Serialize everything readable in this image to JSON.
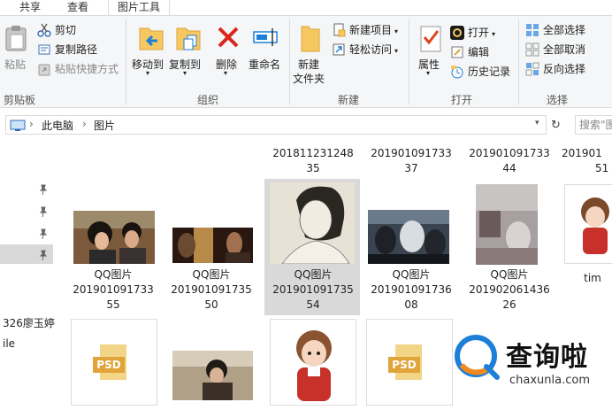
{
  "tabs": {
    "share": "共享",
    "view": "查看",
    "picture_tools": "图片工具"
  },
  "ribbon": {
    "clipboard": {
      "paste": "粘贴",
      "cut": "剪切",
      "copy_path": "复制路径",
      "paste_shortcut": "粘贴快捷方式",
      "label": "剪贴板"
    },
    "organize": {
      "move_to": "移动到",
      "copy_to": "复制到",
      "delete": "删除",
      "rename": "重命名",
      "label": "组织"
    },
    "new": {
      "new_folder_line1": "新建",
      "new_folder_line2": "文件夹",
      "new_item": "新建项目",
      "easy_access": "轻松访问",
      "label": "新建"
    },
    "open": {
      "properties": "属性",
      "open": "打开",
      "edit": "编辑",
      "history": "历史记录",
      "label": "打开"
    },
    "select": {
      "select_all": "全部选择",
      "select_none": "全部取消",
      "invert": "反向选择",
      "label": "选择"
    }
  },
  "address": {
    "this_pc": "此电脑",
    "pictures": "图片",
    "search_placeholder": "搜索\"图"
  },
  "nav": {
    "item_326": "326廖玉婷",
    "item_file": "ile"
  },
  "files": {
    "row0": [
      {
        "line1": "201811231248",
        "line2": "35"
      },
      {
        "line1": "201901091733",
        "line2": "37"
      },
      {
        "line1": "201901091733",
        "line2": "44"
      },
      {
        "line1": "201901",
        "line2": "51"
      }
    ],
    "row1": [
      {
        "line0": "QQ图片",
        "line1": "201901091733",
        "line2": "55"
      },
      {
        "line0": "QQ图片",
        "line1": "201901091735",
        "line2": "50"
      },
      {
        "line0": "QQ图片",
        "line1": "201901091735",
        "line2": "54"
      },
      {
        "line0": "QQ图片",
        "line1": "201901091736",
        "line2": "08"
      },
      {
        "line0": "QQ图片",
        "line1": "201902061436",
        "line2": "26"
      },
      {
        "line0": "tim"
      }
    ],
    "psd_label": "PSD"
  },
  "watermark": {
    "name": "查询啦",
    "url": "chaxunla.com"
  },
  "colors": {
    "accent": "#1e7fd8",
    "selection": "#d9d9d9",
    "ribbon_bg": "#f5f6f7",
    "delete_red": "#d9261c"
  }
}
